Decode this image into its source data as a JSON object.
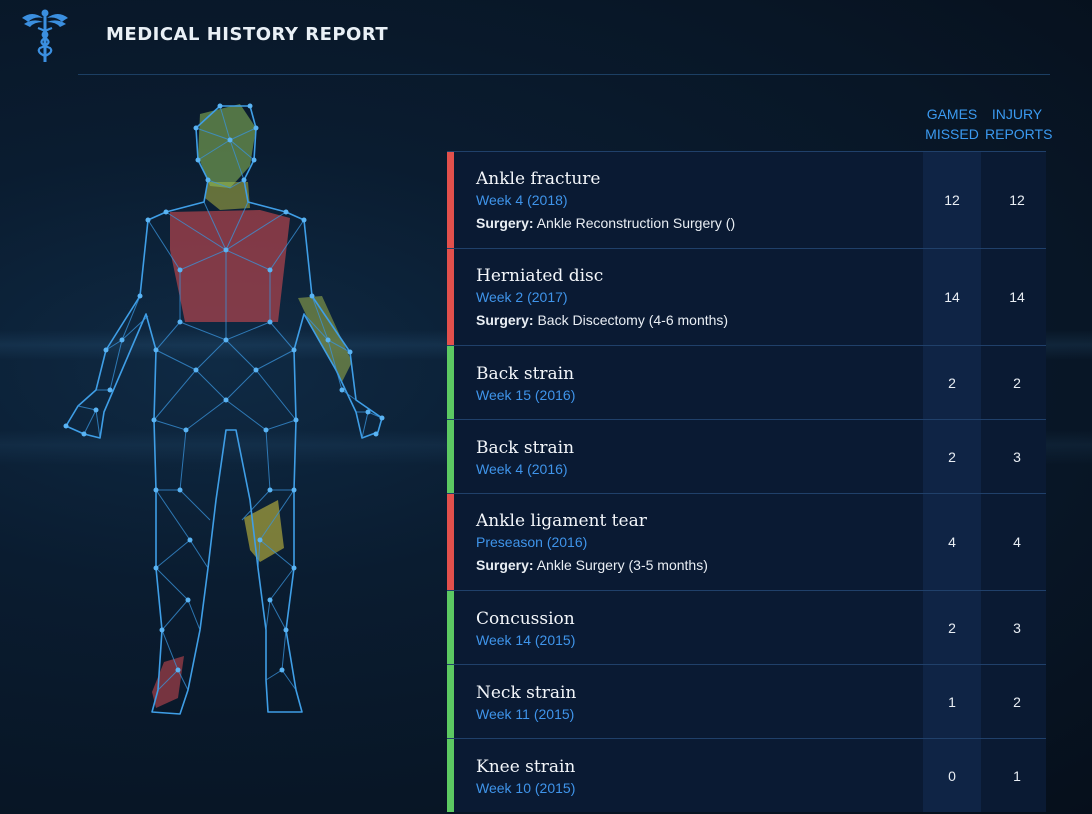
{
  "header": {
    "title": "MEDICAL HISTORY REPORT",
    "logo_icon": "caduceus-icon"
  },
  "columns": {
    "games_missed": "GAMES MISSED",
    "injury_reports": "INJURY REPORTS"
  },
  "colors": {
    "severe": "#e2504c",
    "minor": "#5cc962",
    "accent": "#3f94ea"
  },
  "injuries": [
    {
      "name": "Ankle fracture",
      "when": "Week 4 (2018)",
      "surgery_label": "Surgery:",
      "surgery": "Ankle Reconstruction Surgery ()",
      "games_missed": "12",
      "injury_reports": "12",
      "severity": "severe"
    },
    {
      "name": "Herniated disc",
      "when": "Week 2 (2017)",
      "surgery_label": "Surgery:",
      "surgery": "Back Discectomy (4-6 months)",
      "games_missed": "14",
      "injury_reports": "14",
      "severity": "severe"
    },
    {
      "name": "Back strain",
      "when": "Week 15 (2016)",
      "games_missed": "2",
      "injury_reports": "2",
      "severity": "minor"
    },
    {
      "name": "Back strain",
      "when": "Week 4 (2016)",
      "games_missed": "2",
      "injury_reports": "3",
      "severity": "minor"
    },
    {
      "name": "Ankle ligament tear",
      "when": "Preseason (2016)",
      "surgery_label": "Surgery:",
      "surgery": "Ankle Surgery (3-5 months)",
      "games_missed": "4",
      "injury_reports": "4",
      "severity": "severe"
    },
    {
      "name": "Concussion",
      "when": "Week 14 (2015)",
      "games_missed": "2",
      "injury_reports": "3",
      "severity": "minor"
    },
    {
      "name": "Neck strain",
      "when": "Week 11 (2015)",
      "games_missed": "1",
      "injury_reports": "2",
      "severity": "minor"
    },
    {
      "name": "Knee strain",
      "when": "Week 10 (2015)",
      "games_missed": "0",
      "injury_reports": "1",
      "severity": "minor"
    }
  ]
}
